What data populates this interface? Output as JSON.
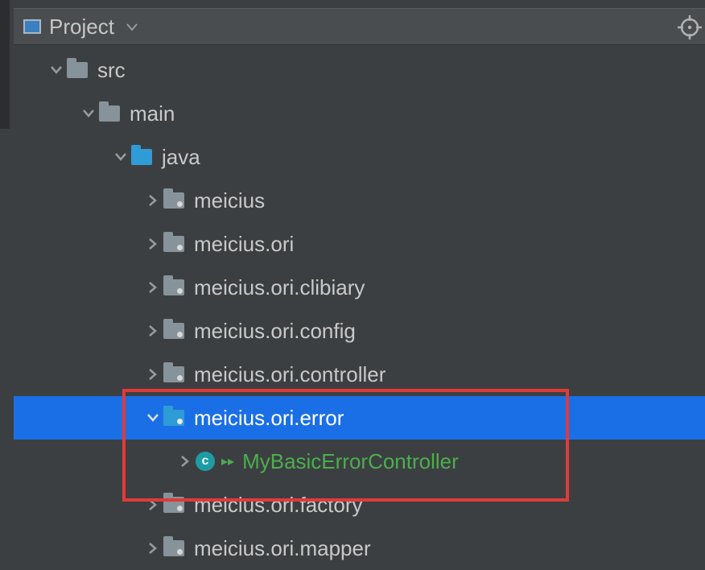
{
  "toolbar": {
    "title": "Project"
  },
  "tree": {
    "src": "src",
    "main": "main",
    "java": "java",
    "packages": [
      "meicius",
      "meicius.ori",
      "meicius.ori.clibiary",
      "meicius.ori.config",
      "meicius.ori.controller",
      "meicius.ori.error",
      "meicius.ori.factory",
      "meicius.ori.mapper"
    ],
    "class_in_error": "MyBasicErrorController"
  },
  "icons": {
    "chevron_down": "˅",
    "chevron_right": "›",
    "class_letter": "c"
  }
}
